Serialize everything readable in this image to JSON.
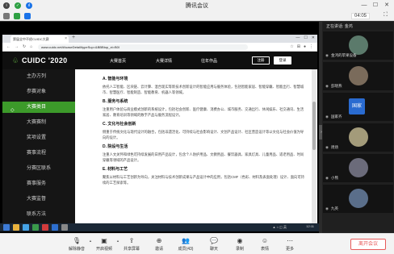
{
  "window": {
    "title": "腾讯会议"
  },
  "meeting": {
    "time": "04:05",
    "speaking": "正在讲话: 金鸿"
  },
  "browser": {
    "tab_title": "第届全中不经CUIDC大赛",
    "url": "www.cuidc.net/#/uaseDetail/typeSup=&BBBtop_xt=B0I"
  },
  "site": {
    "brand": "CUIDC '2020",
    "nav": [
      "大赛首页",
      "大赛详情",
      "往年作品"
    ],
    "login": "注册",
    "register": "登录",
    "sidebar": [
      "主办方列",
      "参赛对象",
      "大赛类目",
      "大赛赛制",
      "奖项设置",
      "赛事流程",
      "分赛区联系",
      "赛事服务",
      "大赛监督",
      "联系方法"
    ],
    "active_index": 2,
    "content": [
      {
        "heading": "A. 智能与环境",
        "text": "依托人工智能、区块链、云计算、混合现实等新技术创新设计的智能应用与服务体验，包括智能家居、智能穿戴、智能出行、智慧城市、智慧医疗、智能制造、智能教育、机器人等领域。"
      },
      {
        "heading": "B. 服务与系统",
        "text": "注重用户体验与商业模式创新的系统设计，包括社会创新、医疗健康、消费办公、城市服务、交通出行、休闲娱乐、社交通讯、生活家居、教育培训等领域的数字产品与服务流程设计。"
      },
      {
        "heading": "C. 文化与社会创新",
        "text": "侧重于传统文化与现代设计的融合，包括非遗活化、可持续与社会影响设计、文创产品设计、社区营造设计等以文化与社会价值为导向的设计。"
      },
      {
        "heading": "D. 院设与生活",
        "text": "注重人文关怀和绿色可持续发展的日用产品设计，包含个人防护用品、文教用品、餐饮器具、家具灯具、儿童用品、适老用品、时尚穿戴等领域的产品设计。"
      },
      {
        "heading": "E. 材料与工艺",
        "text": "聚焦以材料与工艺创新为导向，关注材料与技术创新成果与产品设计中的应用，包括CMF（色彩、材料及表面处理）设计、面向可持续的工艺探索等。"
      }
    ]
  },
  "participants": [
    {
      "name": "金鸿的苹果设备",
      "type": "avatar",
      "color": "#5b7a6b"
    },
    {
      "name": "彭晓燕",
      "type": "avatar",
      "color": "#7a6b5b"
    },
    {
      "name": "国家齐",
      "type": "initials",
      "initials": "国家",
      "color": "#2a6bd0"
    },
    {
      "name": "周炀",
      "type": "avatar",
      "color": "#a39b7a"
    },
    {
      "name": "小熊",
      "type": "avatar",
      "color": "#6b6b7a"
    },
    {
      "name": "九英",
      "type": "avatar",
      "color": "#5a6e8a"
    }
  ],
  "taskbar": {
    "clock": "12:11",
    "date": "2022-01-11"
  },
  "toolbar": {
    "items": [
      "解除静音",
      "开启视频",
      "共享屏幕",
      "邀请",
      "成员(43)",
      "聊天",
      "录制",
      "表情",
      "更多"
    ],
    "leave": "离开会议"
  }
}
